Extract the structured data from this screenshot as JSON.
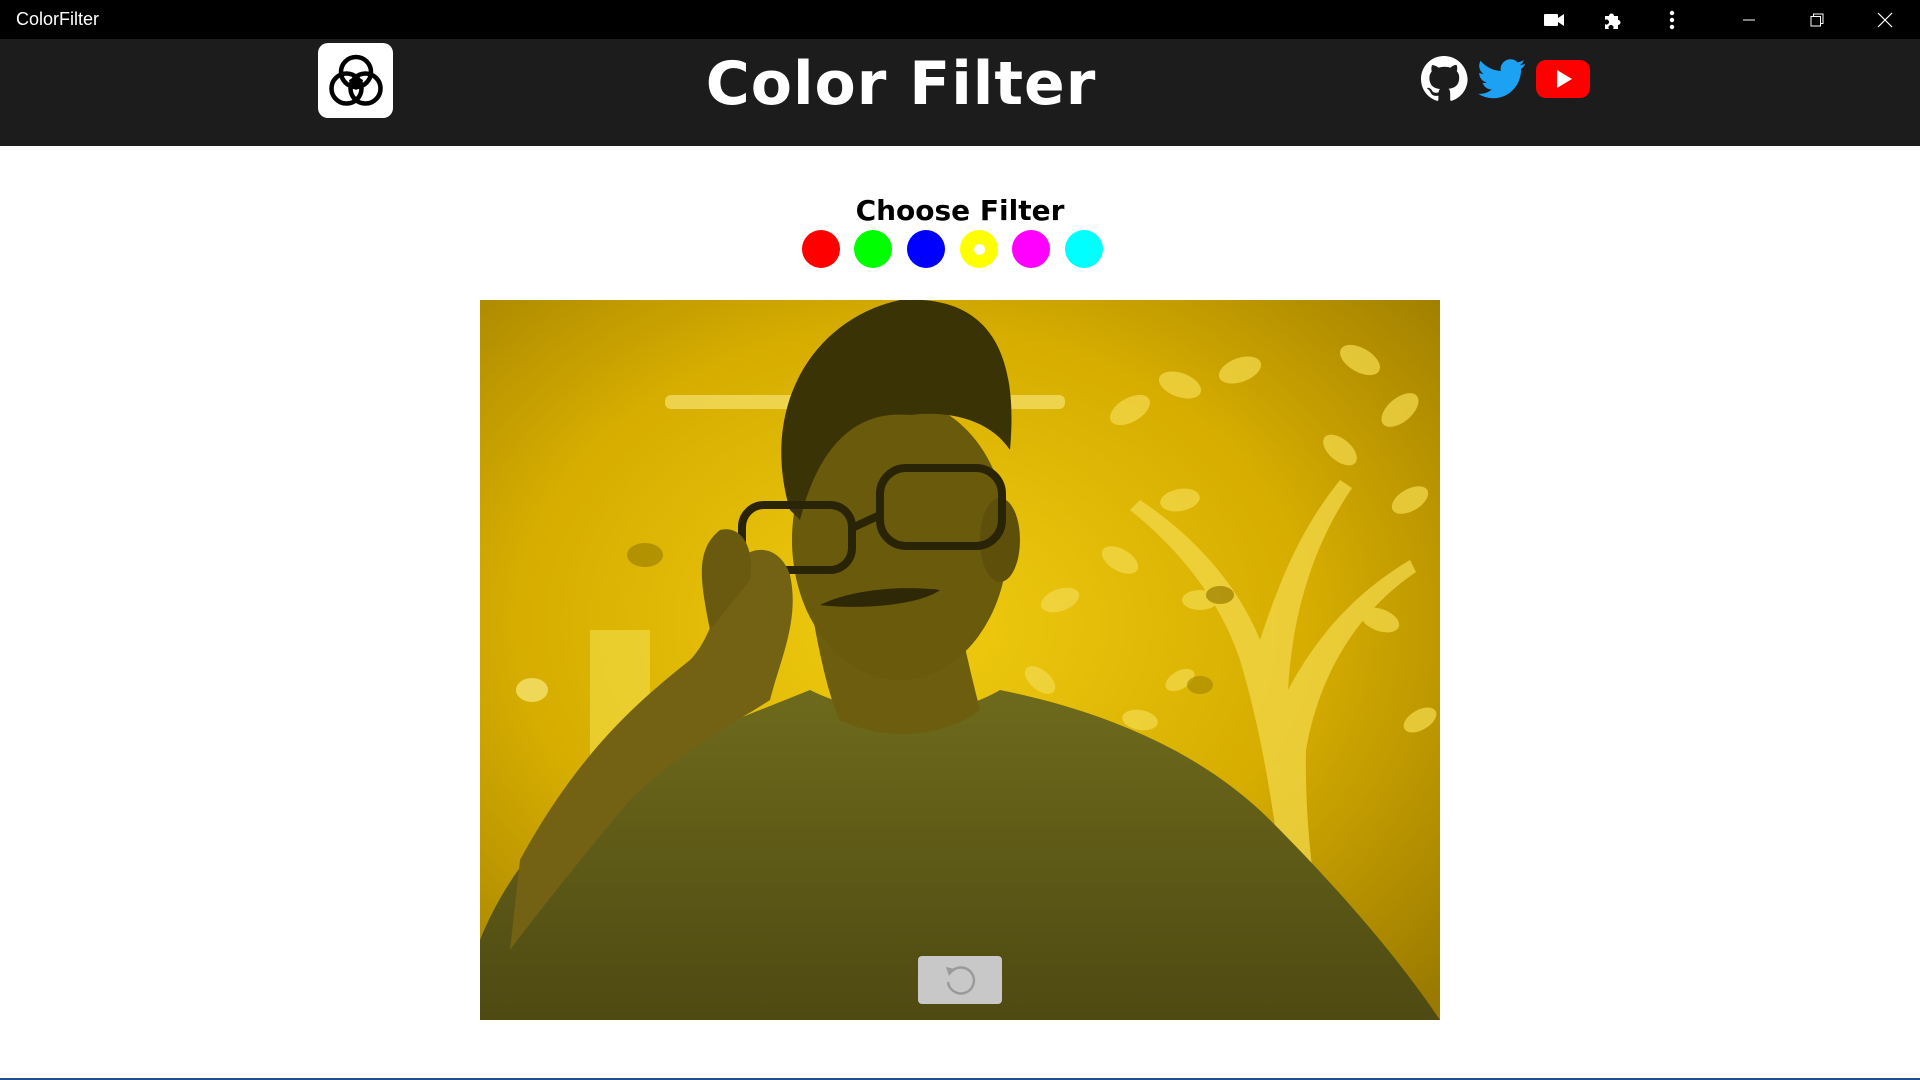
{
  "window": {
    "title": "ColorFilter",
    "toolbar_icons": [
      "camera-icon",
      "extensions-icon",
      "more-icon"
    ],
    "controls": [
      "minimize-icon",
      "restore-icon",
      "close-icon"
    ]
  },
  "header": {
    "logo_icon": "color-filter-logo-icon",
    "title": "Color Filter",
    "social_links": [
      {
        "name": "github-icon",
        "color": "#ffffff"
      },
      {
        "name": "twitter-icon",
        "color": "#1da1f2"
      },
      {
        "name": "youtube-icon",
        "color": "#ff0000"
      }
    ],
    "background": "#1c1c1c"
  },
  "filter": {
    "heading": "Choose Filter",
    "options": [
      {
        "name": "red",
        "color": "#ff0000",
        "selected": false
      },
      {
        "name": "green",
        "color": "#00ff00",
        "selected": false
      },
      {
        "name": "blue",
        "color": "#0000ff",
        "selected": false
      },
      {
        "name": "yellow",
        "color": "#ffff00",
        "selected": true
      },
      {
        "name": "magenta",
        "color": "#ff00ff",
        "selected": false
      },
      {
        "name": "cyan",
        "color": "#00ffff",
        "selected": false
      }
    ]
  },
  "camera": {
    "active_filter": "yellow",
    "reset_icon": "reset-icon"
  }
}
